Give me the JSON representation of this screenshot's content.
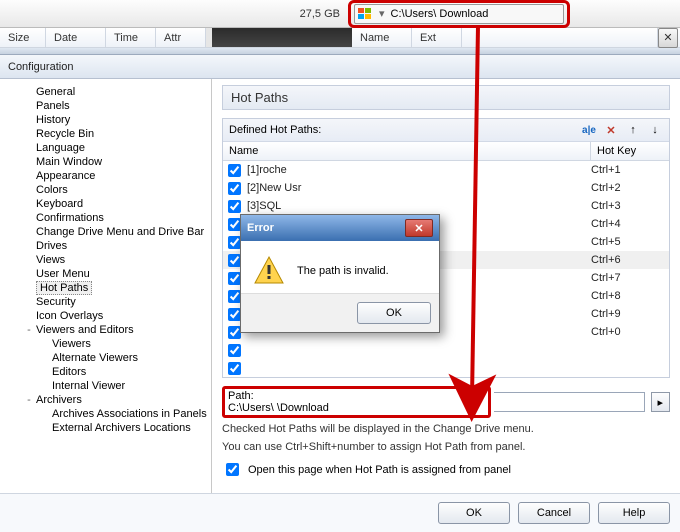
{
  "top": {
    "drive_size": "27,5 GB",
    "path_top": "C:\\Users\\          Download",
    "left_cols": [
      "Size",
      "Date",
      "Time",
      "Attr"
    ],
    "right_cols": [
      "Name",
      "Ext"
    ]
  },
  "config_title": "Configuration",
  "tree": {
    "items": [
      {
        "label": "General",
        "indent": 1
      },
      {
        "label": "Panels",
        "indent": 1
      },
      {
        "label": "History",
        "indent": 1
      },
      {
        "label": "Recycle Bin",
        "indent": 1
      },
      {
        "label": "Language",
        "indent": 1
      },
      {
        "label": "Main Window",
        "indent": 1
      },
      {
        "label": "Appearance",
        "indent": 1
      },
      {
        "label": "Colors",
        "indent": 1
      },
      {
        "label": "Keyboard",
        "indent": 1
      },
      {
        "label": "Confirmations",
        "indent": 1
      },
      {
        "label": "Change Drive Menu and Drive Bar",
        "indent": 1
      },
      {
        "label": "Drives",
        "indent": 1
      },
      {
        "label": "Views",
        "indent": 1
      },
      {
        "label": "User Menu",
        "indent": 1
      },
      {
        "label": "Hot Paths",
        "indent": 1,
        "selected": true
      },
      {
        "label": "Security",
        "indent": 1
      },
      {
        "label": "Icon Overlays",
        "indent": 1
      },
      {
        "label": "Viewers and Editors",
        "indent": 1,
        "exp": "-"
      },
      {
        "label": "Viewers",
        "indent": 2
      },
      {
        "label": "Alternate Viewers",
        "indent": 2
      },
      {
        "label": "Editors",
        "indent": 2
      },
      {
        "label": "Internal Viewer",
        "indent": 2
      },
      {
        "label": "Archivers",
        "indent": 1,
        "exp": "-"
      },
      {
        "label": "Archives Associations in Panels",
        "indent": 2
      },
      {
        "label": "External Archivers Locations",
        "indent": 2
      }
    ]
  },
  "panel": {
    "title": "Hot Paths",
    "group_label": "Defined Hot Paths:",
    "col_name": "Name",
    "col_hotkey": "Hot Key",
    "rows": [
      {
        "checked": true,
        "name": "[1]roche",
        "hotkey": "Ctrl+1"
      },
      {
        "checked": true,
        "name": "[2]New Usr",
        "hotkey": "Ctrl+2"
      },
      {
        "checked": true,
        "name": "[3]SQL",
        "hotkey": "Ctrl+3"
      },
      {
        "checked": true,
        "name": "",
        "hotkey": "Ctrl+4"
      },
      {
        "checked": true,
        "name": "",
        "hotkey": "Ctrl+5"
      },
      {
        "checked": true,
        "name": "",
        "hotkey": "Ctrl+6",
        "sel": true
      },
      {
        "checked": true,
        "name": "",
        "hotkey": "Ctrl+7"
      },
      {
        "checked": true,
        "name": "",
        "hotkey": "Ctrl+8"
      },
      {
        "checked": true,
        "name": "",
        "hotkey": "Ctrl+9"
      },
      {
        "checked": true,
        "name": "",
        "hotkey": "Ctrl+0"
      },
      {
        "checked": true,
        "name": "",
        "hotkey": ""
      },
      {
        "checked": true,
        "name": "",
        "hotkey": ""
      }
    ],
    "path_label": "Path:",
    "path_value": "C:\\Users\\          \\Download",
    "hint1": "Checked Hot Paths will be displayed in the Change Drive menu.",
    "hint2": "You can use Ctrl+Shift+number to assign Hot Path from panel.",
    "open_chk": "Open this page when Hot Path is assigned from panel"
  },
  "buttons": {
    "ok": "OK",
    "cancel": "Cancel",
    "help": "Help"
  },
  "error": {
    "title": "Error",
    "msg": "The path is invalid.",
    "ok": "OK"
  }
}
